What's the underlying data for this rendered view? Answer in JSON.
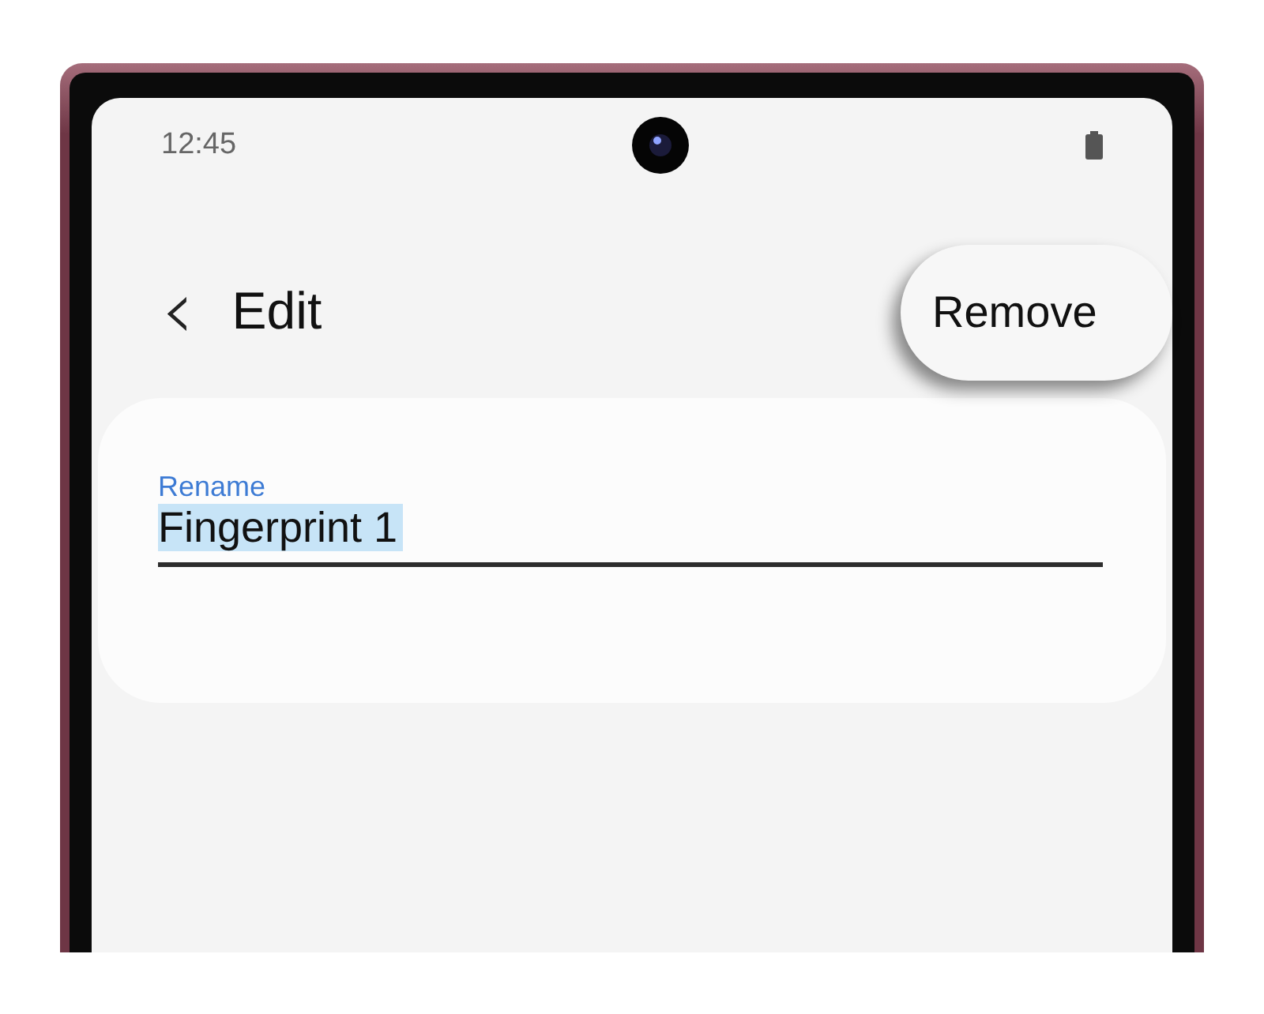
{
  "status_bar": {
    "time": "12:45"
  },
  "header": {
    "title": "Edit",
    "back_icon": "‹"
  },
  "actions": [
    {
      "label": "Remove"
    }
  ],
  "rename_field": {
    "label": "Rename",
    "value": "Fingerprint 1",
    "selected": true
  }
}
